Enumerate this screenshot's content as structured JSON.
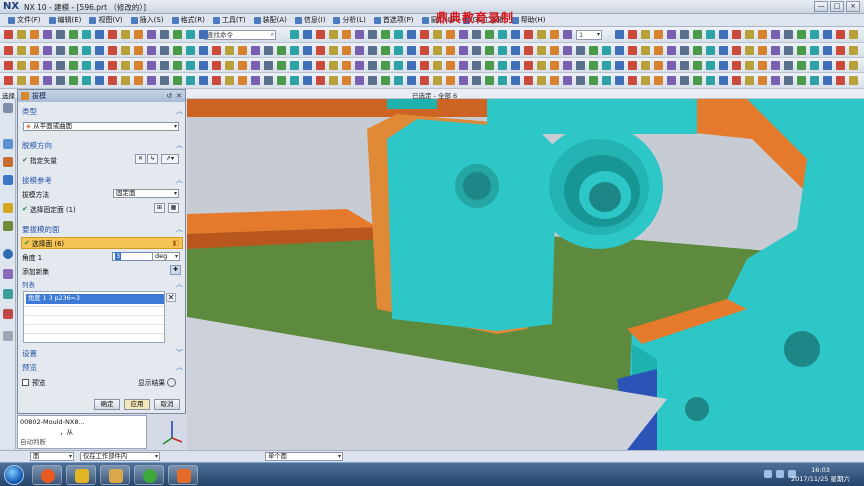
{
  "window": {
    "logo": "NX",
    "title": "NX 10 - 建模 - [596.prt （修改的）]",
    "watermark": "鼎典教育录制",
    "controls": [
      "—",
      "□",
      "×"
    ]
  },
  "menu": [
    "文件(F)",
    "编辑(E)",
    "视图(V)",
    "插入(S)",
    "格式(R)",
    "工具(T)",
    "装配(A)",
    "信息(I)",
    "分析(L)",
    "首选项(P)",
    "窗口(O)",
    "GC工具箱",
    "帮助(H)"
  ],
  "toolbar": {
    "search_placeholder": "查找命令",
    "layer_value": "1"
  },
  "cue": {
    "left": "选择",
    "center": "已选定 - 全部 6"
  },
  "dialog": {
    "title": "拔模",
    "sections": {
      "type": {
        "header": "类型",
        "value": "从平面或曲面"
      },
      "draft_direction": {
        "header": "脱模方向",
        "item": "指定矢量"
      },
      "draft_reference": {
        "header": "拔模参考",
        "method_label": "拔模方法",
        "method_value": "固定面",
        "select_label": "选择固定面 (1)"
      },
      "faces": {
        "header": "要拔模的面",
        "select_label": "选择面 (6)",
        "angle_label": "角度 1",
        "angle_value": "3",
        "angle_unit": "deg",
        "add_set": "添加新集",
        "list_header": "列表",
        "list_row": "角度 1   3   p236=3"
      },
      "settings": {
        "header": "设置"
      },
      "preview": {
        "header": "预览",
        "preview_label": "预览",
        "show_result": "显示结果"
      }
    },
    "buttons": {
      "ok": "确定",
      "apply": "应用",
      "cancel": "取消"
    }
  },
  "navigator": {
    "line1": "00802-Mould-NX8...",
    "line2": "，从",
    "line3": "自动判断"
  },
  "filters": {
    "type_filter": "面",
    "scope_filter": "仅在工作部件内",
    "face_rule": "单个面"
  },
  "taskbar": {
    "time": "16:03",
    "date": "2017/11/25 星期六"
  },
  "colors": {
    "model_cyan": "#2cc7c6",
    "model_orange": "#e57a2c",
    "floor_green": "#5d8a3c",
    "selection_highlight": "#f6c454",
    "watermark": "#d2151b"
  }
}
